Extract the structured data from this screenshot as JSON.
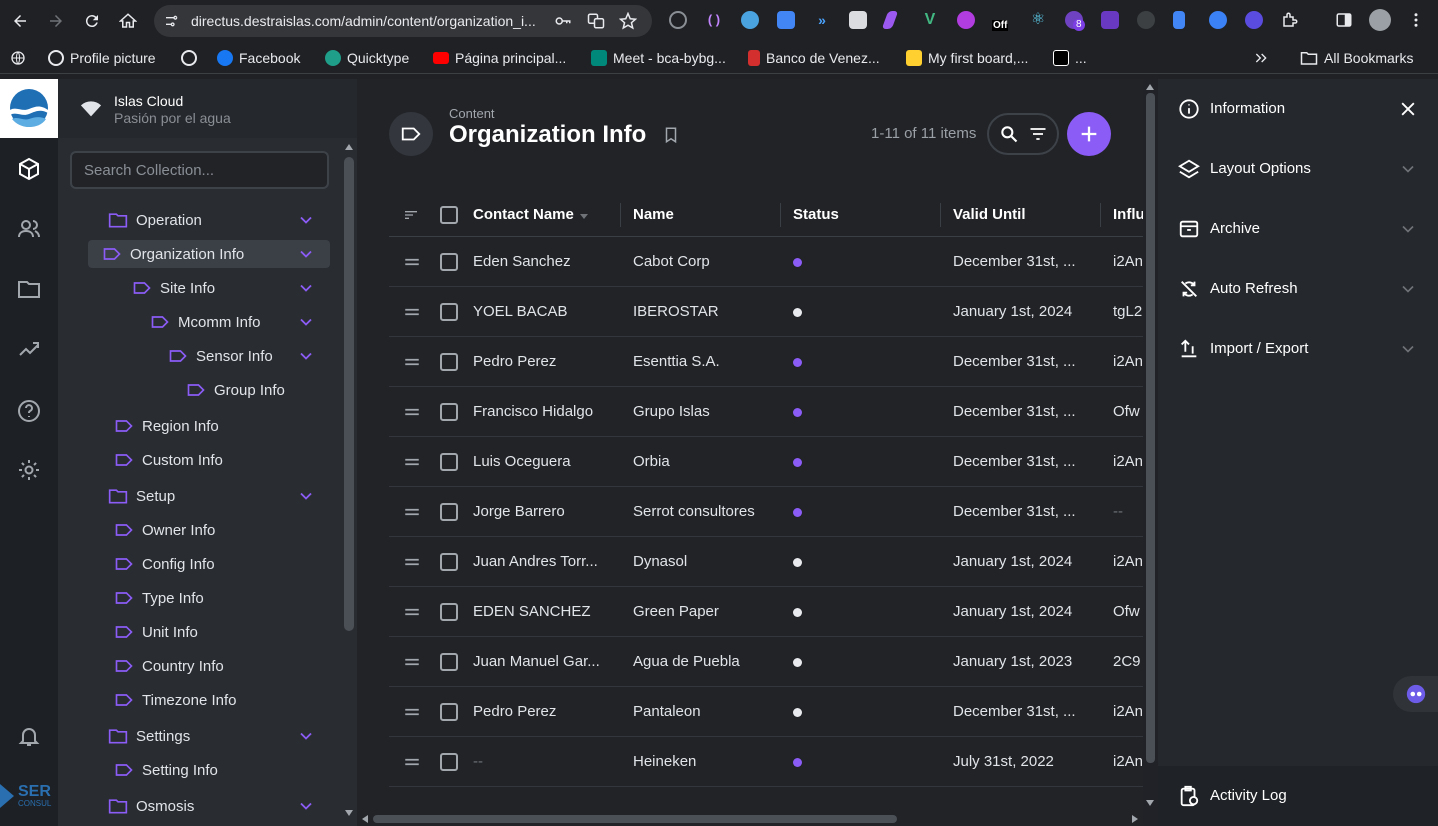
{
  "browser": {
    "url": "directus.destraislas.com/admin/content/organization_i...",
    "bookmarks": [
      "Profile picture",
      "Facebook",
      "Quicktype",
      "Página principal...",
      "Meet - bca-bybg...",
      "Banco de Venez...",
      "My first board,...",
      "..."
    ],
    "all_bookmarks": "All Bookmarks",
    "ext_badge_off": "Off",
    "ext_badge_count": "8"
  },
  "project": {
    "name": "Islas Cloud",
    "subtitle": "Pasión por el agua"
  },
  "nav": {
    "search_placeholder": "Search Collection...",
    "items": [
      {
        "label": "Operation",
        "type": "folder"
      },
      {
        "label": "Organization Info",
        "type": "collection"
      },
      {
        "label": "Site Info",
        "type": "collection"
      },
      {
        "label": "Mcomm Info",
        "type": "collection"
      },
      {
        "label": "Sensor Info",
        "type": "collection"
      },
      {
        "label": "Group Info",
        "type": "collection"
      },
      {
        "label": "Region Info",
        "type": "collection"
      },
      {
        "label": "Custom Info",
        "type": "collection"
      },
      {
        "label": "Setup",
        "type": "folder"
      },
      {
        "label": "Owner Info",
        "type": "collection"
      },
      {
        "label": "Config Info",
        "type": "collection"
      },
      {
        "label": "Type Info",
        "type": "collection"
      },
      {
        "label": "Unit Info",
        "type": "collection"
      },
      {
        "label": "Country Info",
        "type": "collection"
      },
      {
        "label": "Timezone Info",
        "type": "collection"
      },
      {
        "label": "Settings",
        "type": "folder"
      },
      {
        "label": "Setting Info",
        "type": "collection"
      },
      {
        "label": "Osmosis",
        "type": "folder"
      }
    ]
  },
  "header": {
    "breadcrumb": "Content",
    "title": "Organization Info",
    "count": "1-11 of 11 items"
  },
  "table": {
    "columns": [
      "Contact Name",
      "Name",
      "Status",
      "Valid Until",
      "Influ"
    ],
    "rows": [
      {
        "contact": "Eden Sanchez",
        "name": "Cabot Corp",
        "status": "published",
        "valid": "December 31st, ...",
        "influ": "i2An"
      },
      {
        "contact": "YOEL BACAB",
        "name": "IBEROSTAR",
        "status": "draft",
        "valid": "January 1st, 2024",
        "influ": "tgL2"
      },
      {
        "contact": "Pedro Perez",
        "name": "Esenttia S.A.",
        "status": "published",
        "valid": "December 31st, ...",
        "influ": "i2An"
      },
      {
        "contact": "Francisco Hidalgo",
        "name": "Grupo Islas",
        "status": "published",
        "valid": "December 31st, ...",
        "influ": "Ofw"
      },
      {
        "contact": "Luis Oceguera",
        "name": "Orbia",
        "status": "published",
        "valid": "December 31st, ...",
        "influ": "i2An"
      },
      {
        "contact": "Jorge Barrero",
        "name": "Serrot consultores",
        "status": "published",
        "valid": "December 31st, ...",
        "influ": "--"
      },
      {
        "contact": "Juan Andres Torr...",
        "name": "Dynasol",
        "status": "draft",
        "valid": "January 1st, 2024",
        "influ": "i2An"
      },
      {
        "contact": "EDEN SANCHEZ",
        "name": "Green Paper",
        "status": "draft",
        "valid": "January 1st, 2024",
        "influ": "Ofw"
      },
      {
        "contact": "Juan Manuel Gar...",
        "name": "Agua de Puebla",
        "status": "draft",
        "valid": "January 1st, 2023",
        "influ": "2C9"
      },
      {
        "contact": "Pedro Perez",
        "name": "Pantaleon",
        "status": "draft",
        "valid": "December 31st, ...",
        "influ": "i2An"
      },
      {
        "contact": "--",
        "name": "Heineken",
        "status": "published",
        "valid": "July 31st, 2022",
        "influ": "i2An"
      }
    ]
  },
  "sidebar": {
    "information": "Information",
    "layout_options": "Layout Options",
    "archive": "Archive",
    "auto_refresh": "Auto Refresh",
    "import_export": "Import / Export",
    "activity_log": "Activity Log"
  },
  "colors": {
    "accent": "#8b5cf6",
    "published": "#8b5cf6",
    "draft": "#e8eaed"
  }
}
